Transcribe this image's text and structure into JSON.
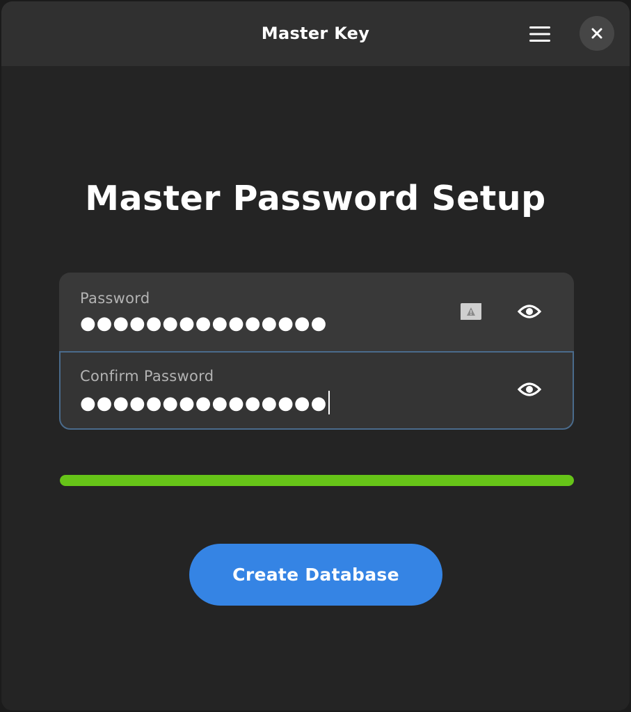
{
  "window": {
    "title": "Master Key",
    "menu_icon": "hamburger-menu-icon",
    "close_icon": "close-icon"
  },
  "page": {
    "title": "Master Password Setup"
  },
  "password_field": {
    "label": "Password",
    "value": "●●●●●●●●●●●●●●●",
    "caps_icon": "caps-lock-warning-icon",
    "reveal_icon": "eye-icon"
  },
  "confirm_field": {
    "label": "Confirm Password",
    "value": "●●●●●●●●●●●●●●●",
    "reveal_icon": "eye-icon"
  },
  "strength": {
    "level": 1.0,
    "color": "#66c418"
  },
  "actions": {
    "create_label": "Create Database",
    "create_color": "#3584e4"
  }
}
